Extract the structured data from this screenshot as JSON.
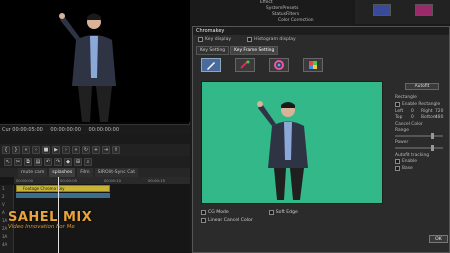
{
  "preview": {
    "timecode_left": "Cur 00:00:05:00",
    "timecode_mid": "00:00:00:00",
    "timecode_right": "00:00:00:00"
  },
  "tabs": [
    "mute cam",
    "splashes",
    "Film",
    "SIROlit-Sync Cat"
  ],
  "active_tab_index": 1,
  "timeline": {
    "ruler_ticks": [
      "00:00:00",
      "00:00:05",
      "00:00:10",
      "00:00:15"
    ],
    "clip_label": "Footage Chroma Key",
    "tracks": [
      "1",
      "2",
      "V",
      "A",
      "1A",
      "2A",
      "3A",
      "4A"
    ]
  },
  "watermark": {
    "title": "SAHEL MIX",
    "subtitle": "Video Innovation For Me"
  },
  "right_tree": [
    "Effect",
    "SystemPresets",
    "StatusFilters",
    "Color Correction"
  ],
  "dialog": {
    "title": "Chromakey",
    "key_display": "Key display",
    "histogram_display": "Histogram display",
    "tabs": [
      "Key Setting",
      "Key Frame Setting"
    ],
    "active_tab_index": 1,
    "options": {
      "cg_mode": "CG Mode",
      "soft_edge": "Soft Edge",
      "linear_cancel": "Linear Cancel Color"
    },
    "right_panel": {
      "autofit": "Autofit",
      "rectangle": "Rectangle",
      "enable_rectangle": "Enable Rectangle",
      "left": "Left",
      "right": "Right",
      "top": "Top",
      "bottom": "Bottom",
      "left_val": "0",
      "right_val": "720",
      "top_val": "0",
      "bottom_val": "480",
      "cancel_color": "Cancel Color",
      "range": "Range",
      "power": "Power",
      "autofit_tracking": "Autofit tracking",
      "enable": "Enable",
      "base": "Base"
    },
    "ok": "OK"
  },
  "colors": {
    "key_green": "#33b889",
    "clip_yellow": "#c9b43a",
    "watermark_orange": "#e8a33d"
  }
}
